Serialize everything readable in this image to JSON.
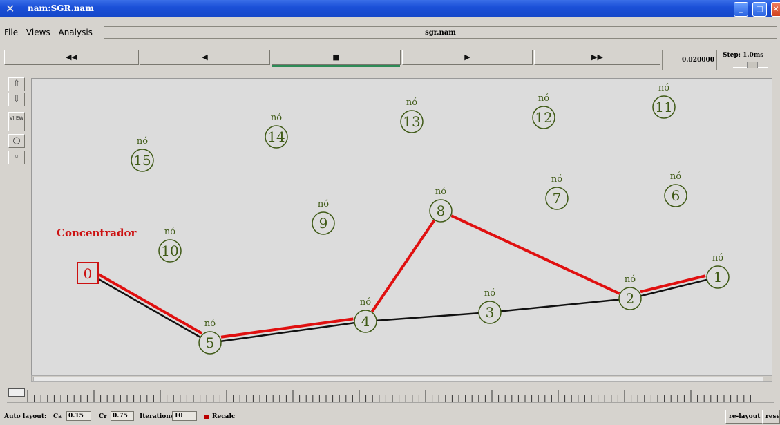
{
  "window": {
    "title": "nam:SGR.nam",
    "minimize": "_",
    "maximize": "□",
    "close": "×"
  },
  "menubar": {
    "menus": [
      {
        "label": "File"
      },
      {
        "label": "Views"
      },
      {
        "label": "Analysis"
      }
    ],
    "filename": "sgr.nam"
  },
  "playback": {
    "buttons": [
      {
        "name": "fast-rewind-button",
        "glyph": "◀◀",
        "active": false
      },
      {
        "name": "rewind-button",
        "glyph": "◀",
        "active": false
      },
      {
        "name": "stop-button",
        "glyph": "■",
        "active": true
      },
      {
        "name": "play-button",
        "glyph": "▶",
        "active": false
      },
      {
        "name": "fast-forward-button",
        "glyph": "▶▶",
        "active": false
      }
    ],
    "time": "0.020000",
    "step_label": "Step: 1.0ms"
  },
  "sidebar": {
    "items": [
      {
        "name": "zoom-in-icon",
        "glyph": "⇧"
      },
      {
        "name": "zoom-out-icon",
        "glyph": "⇩"
      },
      {
        "name": "view-button",
        "glyph": "VI EW"
      },
      {
        "name": "circle-large-icon",
        "glyph": "○"
      },
      {
        "name": "circle-small-icon",
        "glyph": "◦"
      }
    ]
  },
  "network": {
    "node_caption": "nó",
    "hub_label": "Concentrador",
    "hub_id": "0",
    "colors": {
      "node": "#3f5a16",
      "hub": "#cc1111",
      "link": "#111111",
      "flow": "#e01010"
    },
    "nodes": [
      {
        "id": "1"
      },
      {
        "id": "2"
      },
      {
        "id": "3"
      },
      {
        "id": "4"
      },
      {
        "id": "5"
      },
      {
        "id": "6"
      },
      {
        "id": "7"
      },
      {
        "id": "8"
      },
      {
        "id": "9"
      },
      {
        "id": "10"
      },
      {
        "id": "11"
      },
      {
        "id": "12"
      },
      {
        "id": "13"
      },
      {
        "id": "14"
      },
      {
        "id": "15"
      }
    ],
    "links": [
      [
        "0",
        "5"
      ],
      [
        "5",
        "4"
      ],
      [
        "4",
        "3"
      ],
      [
        "3",
        "2"
      ],
      [
        "2",
        "1"
      ]
    ],
    "flows": [
      [
        "0",
        "5"
      ],
      [
        "5",
        "4"
      ],
      [
        "4",
        "8"
      ],
      [
        "8",
        "2"
      ],
      [
        "2",
        "1"
      ]
    ]
  },
  "statusbar": {
    "auto_layout_label": "Auto layout:",
    "ca_label": "Ca",
    "ca_value": "0.15",
    "cr_label": "Cr",
    "cr_value": "0.75",
    "iterations_label": "Iterations",
    "iterations_value": "10",
    "recalc_label": "Recalc",
    "relayout_label": "re-layout",
    "reset_label": "reset"
  }
}
